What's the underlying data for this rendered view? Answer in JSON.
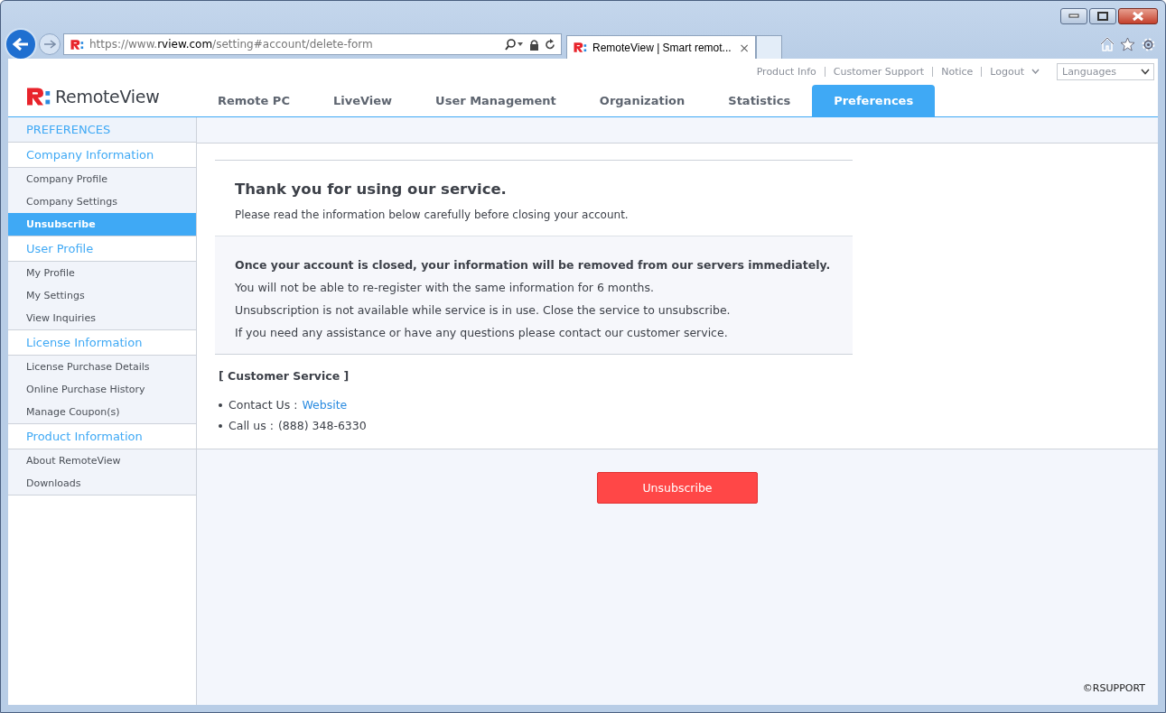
{
  "browser": {
    "url": {
      "prefix": "https://www.",
      "domain": "rview.com",
      "path": "/setting#account/delete-form"
    },
    "tabs": [
      {
        "title": "RemoteView | Smart remot...",
        "close": "×",
        "selected": true
      }
    ]
  },
  "header": {
    "logo_text": "RemoteView",
    "top_links": [
      {
        "label": "Product Info",
        "kind": "link"
      },
      {
        "label": "Customer Support",
        "kind": "link"
      },
      {
        "label": "Notice",
        "kind": "link"
      },
      {
        "label": "Logout",
        "kind": "menu"
      }
    ],
    "language_select": {
      "value": "Languages"
    },
    "nav": [
      {
        "label": "Remote PC",
        "selected": false
      },
      {
        "label": "LiveView",
        "selected": false
      },
      {
        "label": "User Management",
        "selected": false
      },
      {
        "label": "Organization",
        "selected": false
      },
      {
        "label": "Statistics",
        "selected": false
      },
      {
        "label": "Preferences",
        "selected": true
      }
    ]
  },
  "sidebar": {
    "title": "PREFERENCES",
    "groups": [
      {
        "label": "Company Information",
        "items": [
          {
            "label": "Company Profile",
            "selected": false
          },
          {
            "label": "Company Settings",
            "selected": false
          },
          {
            "label": "Unsubscribe",
            "selected": true
          }
        ]
      },
      {
        "label": "User Profile",
        "items": [
          {
            "label": "My Profile",
            "selected": false
          },
          {
            "label": "My Settings",
            "selected": false
          },
          {
            "label": "View Inquiries",
            "selected": false
          }
        ]
      },
      {
        "label": "License Information",
        "items": [
          {
            "label": "License Purchase Details",
            "selected": false
          },
          {
            "label": "Online Purchase History",
            "selected": false
          },
          {
            "label": "Manage Coupon(s)",
            "selected": false
          }
        ]
      },
      {
        "label": "Product Information",
        "items": [
          {
            "label": "About RemoteView",
            "selected": false
          },
          {
            "label": "Downloads",
            "selected": false
          }
        ]
      }
    ]
  },
  "content": {
    "heading": "Thank you for using our service.",
    "intro": "Please read the information below carefully before closing your account.",
    "notice": {
      "lead": "Once your account is closed, your information will be removed from our servers immediately.",
      "lines": [
        "You will not be able to re-register with the same information for 6 months.",
        "Unsubscription is not available while service is in use. Close the service to unsubscribe.",
        "If you need any assistance or have any questions please contact our customer service."
      ]
    },
    "customer_service": {
      "title": "[ Customer Service ]",
      "contact_label": "Contact Us :",
      "contact_link": "Website",
      "call_label": "Call us :",
      "phone": "(888) 348-6330"
    },
    "button": "Unsubscribe",
    "copyright": "©RSUPPORT"
  }
}
